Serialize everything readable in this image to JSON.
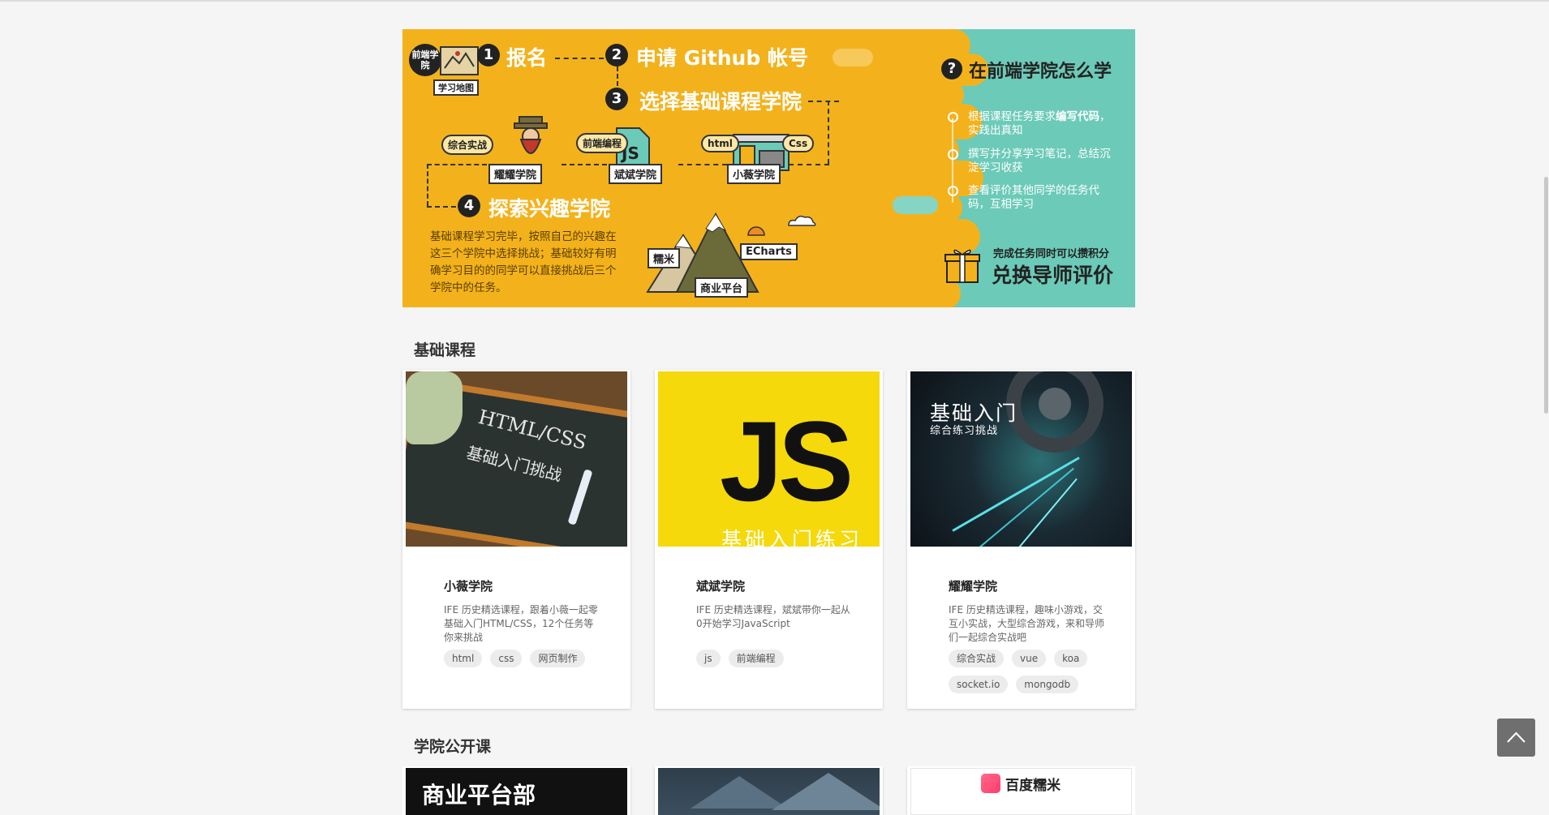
{
  "banner": {
    "brand_logo": "前端学院",
    "map_label": "学习地图",
    "steps": [
      {
        "num": "1",
        "title": "报名"
      },
      {
        "num": "2",
        "title": "申请 Github 帐号"
      },
      {
        "num": "3",
        "title": "选择基础课程学院"
      },
      {
        "num": "4",
        "title": "探索兴趣学院"
      }
    ],
    "schools": {
      "yaoyao": "耀耀学院",
      "binbin": "斌斌学院",
      "xiaowei": "小薇学院",
      "nuomi": "糯米",
      "echarts": "ECharts",
      "business": "商业平台"
    },
    "bubbles": {
      "zonghe": "综合实战",
      "qianduan": "前端编程",
      "html": "html",
      "css": "Css"
    },
    "desc": "基础课程学习完毕，按照自己的兴趣在这三个学院中选择挑战；基础较好有明确学习目的的同学可以直接挑战后三个学院中的任务。",
    "how_title": "在前端学院怎么学",
    "tips": [
      {
        "pre": "根据课程任务要求",
        "bold": "编写代码",
        "post": "，实践出真知"
      },
      {
        "pre": "撰写并分享学习笔记，总结沉淀学习收获",
        "bold": "",
        "post": ""
      },
      {
        "pre": "查看评价其他同学的任务代码，互相学习",
        "bold": "",
        "post": ""
      }
    ],
    "gift_small": "完成任务同时可以攒积分",
    "gift_big": "兑换导师评价"
  },
  "basic_section": {
    "title": "基础课程",
    "courses": [
      {
        "name": "小薇学院",
        "img_title": "HTML/CSS",
        "img_sub": "基础入门挑战",
        "desc": "IFE 历史精选课程，跟着小薇一起零基础入门HTML/CSS，12个任务等你来挑战",
        "tags": [
          "html",
          "css",
          "网页制作"
        ]
      },
      {
        "name": "斌斌学院",
        "img_title": "JS",
        "img_sub": "基础入门练习",
        "desc": "IFE 历史精选课程，斌斌带你一起从0开始学习JavaScript",
        "tags": [
          "js",
          "前端编程"
        ]
      },
      {
        "name": "耀耀学院",
        "img_title": "基础入门",
        "img_sub": "综合练习挑战",
        "desc": "IFE 历史精选课程，趣味小游戏，交互小实战，大型综合游戏，来和导师们一起综合实战吧",
        "tags": [
          "综合实战",
          "vue",
          "koa",
          "socket.io",
          "mongodb"
        ]
      }
    ]
  },
  "open_section": {
    "title": "学院公开课",
    "cards": [
      {
        "img_text": "商业平台部"
      },
      {
        "img_text": ""
      },
      {
        "img_text": "百度糯米"
      }
    ]
  },
  "colors": {
    "banner_yellow": "#f3b21c",
    "banner_teal": "#6ccab8",
    "js_yellow": "#f5d90a",
    "back_top": "#6f6f6f"
  }
}
